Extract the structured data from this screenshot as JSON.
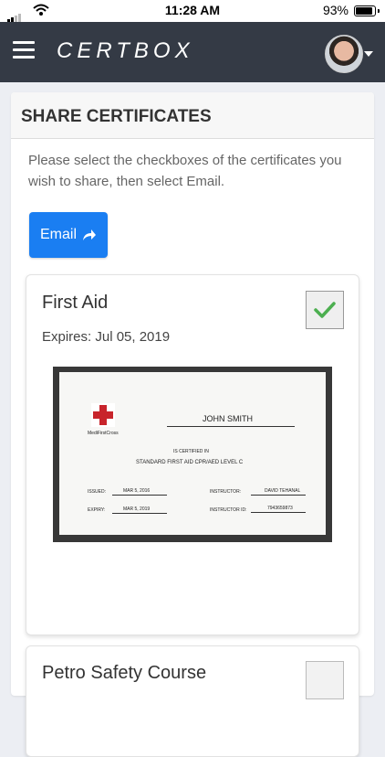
{
  "status_bar": {
    "time": "11:28 AM",
    "battery_percent": "93%"
  },
  "navbar": {
    "brand": "CERTBOX"
  },
  "page": {
    "title": "SHARE CERTIFICATES",
    "instructions": "Please select the checkboxes of the certificates you wish to share, then select Email.",
    "email_button_label": "Email"
  },
  "certificates": [
    {
      "name": "First Aid",
      "expires": "Expires: Jul 05, 2019",
      "selected": true,
      "image": {
        "brand": "MediFirstCross",
        "holder_name": "JOHN SMITH",
        "certified_text": "IS CERTIFIED IN",
        "course": "STANDARD FIRST AID CPR/AED LEVEL C",
        "issued_label": "ISSUED:",
        "issued": "MAR 5, 2016",
        "expiry_label": "EXPIRY:",
        "expiry": "MAR 5, 2019",
        "instructor_label": "INSTRUCTOR:",
        "instructor": "DAVID TEHANAL",
        "instructor_id_label": "INSTRUCTOR ID:",
        "instructor_id": "7943659873"
      }
    },
    {
      "name": "Petro Safety Course",
      "selected": false
    }
  ],
  "colors": {
    "navbar": "#343a45",
    "accent": "#1a7ef2",
    "check": "#4caf50"
  },
  "icons": {
    "menu": "hamburger-icon",
    "email": "share-arrow-icon",
    "avatar": "user-avatar",
    "check": "checkmark-icon"
  }
}
